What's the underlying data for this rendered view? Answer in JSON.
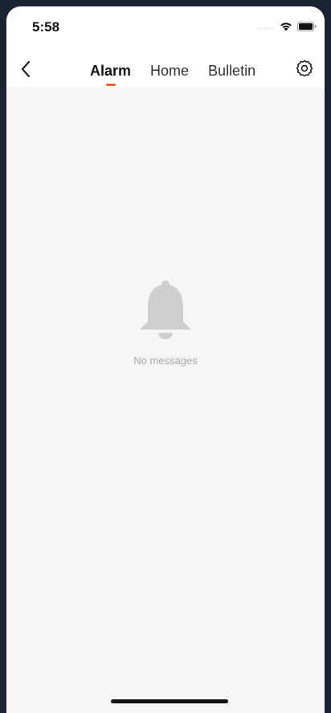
{
  "status_bar": {
    "time": "5:58",
    "signal_icon": "signal-dots-icon",
    "wifi_icon": "wifi-icon",
    "battery_icon": "battery-icon"
  },
  "nav": {
    "back_icon": "chevron-left-icon",
    "tabs": [
      {
        "label": "Alarm",
        "active": true
      },
      {
        "label": "Home",
        "active": false
      },
      {
        "label": "Bulletin",
        "active": false
      }
    ],
    "settings_icon": "gear-icon"
  },
  "empty_state": {
    "icon": "bell-icon",
    "message": "No messages"
  },
  "colors": {
    "accent": "#f0622d",
    "background": "#f6f6f6",
    "outer": "#1a2233"
  }
}
